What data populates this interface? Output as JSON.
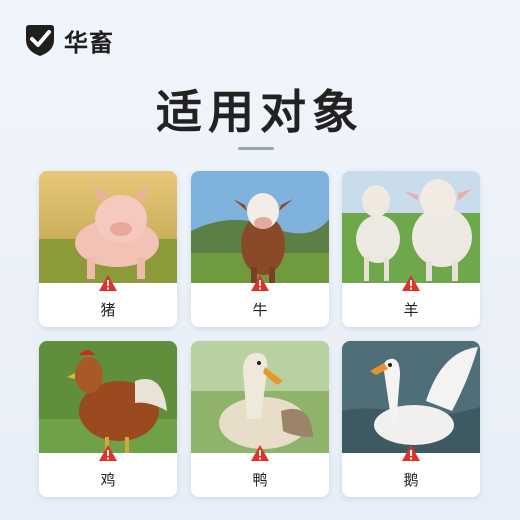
{
  "brand": {
    "name": "华畜",
    "logo_icon": "shield-check-icon"
  },
  "page": {
    "title": "适用对象"
  },
  "animals": [
    {
      "label": "猪",
      "icon": "warning-icon"
    },
    {
      "label": "牛",
      "icon": "warning-icon"
    },
    {
      "label": "羊",
      "icon": "warning-icon"
    },
    {
      "label": "鸡",
      "icon": "warning-icon"
    },
    {
      "label": "鸭",
      "icon": "warning-icon"
    },
    {
      "label": "鹅",
      "icon": "warning-icon"
    }
  ],
  "colors": {
    "warning": "#e0312b",
    "title": "#222222"
  }
}
